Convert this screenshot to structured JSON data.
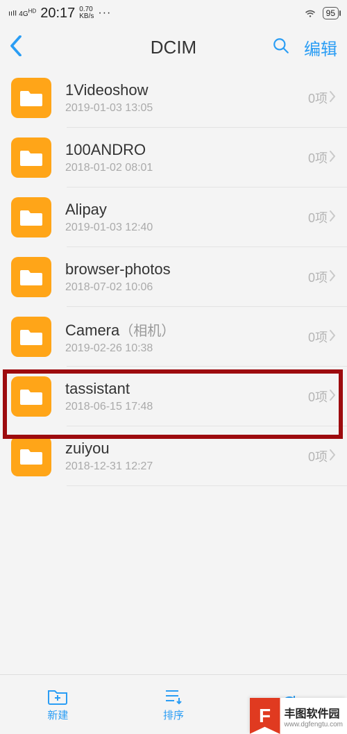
{
  "status": {
    "signal": "4G HD",
    "time": "20:17",
    "speed_top": "0.70",
    "speed_bottom": "KB/s",
    "dots": "···",
    "battery": "95"
  },
  "nav": {
    "title": "DCIM",
    "edit": "编辑"
  },
  "folders": [
    {
      "name": "1Videoshow",
      "suffix": "",
      "date": "2019-01-03 13:05",
      "count": "0项"
    },
    {
      "name": "100ANDRO",
      "suffix": "",
      "date": "2018-01-02 08:01",
      "count": "0项"
    },
    {
      "name": "Alipay",
      "suffix": "",
      "date": "2019-01-03 12:40",
      "count": "0项"
    },
    {
      "name": "browser-photos",
      "suffix": "",
      "date": "2018-07-02 10:06",
      "count": "0项"
    },
    {
      "name": "Camera",
      "suffix": "（相机）",
      "date": "2019-02-26 10:38",
      "count": "0项"
    },
    {
      "name": "tassistant",
      "suffix": "",
      "date": "2018-06-15 17:48",
      "count": "0项"
    },
    {
      "name": "zuiyou",
      "suffix": "",
      "date": "2018-12-31 12:27",
      "count": "0项"
    }
  ],
  "bottom": {
    "new": "新建",
    "sort": "排序",
    "refresh": ""
  },
  "watermark": {
    "badge": "F",
    "title": "丰图软件园",
    "url": "www.dgfengtu.com"
  },
  "highlight_index": 4
}
